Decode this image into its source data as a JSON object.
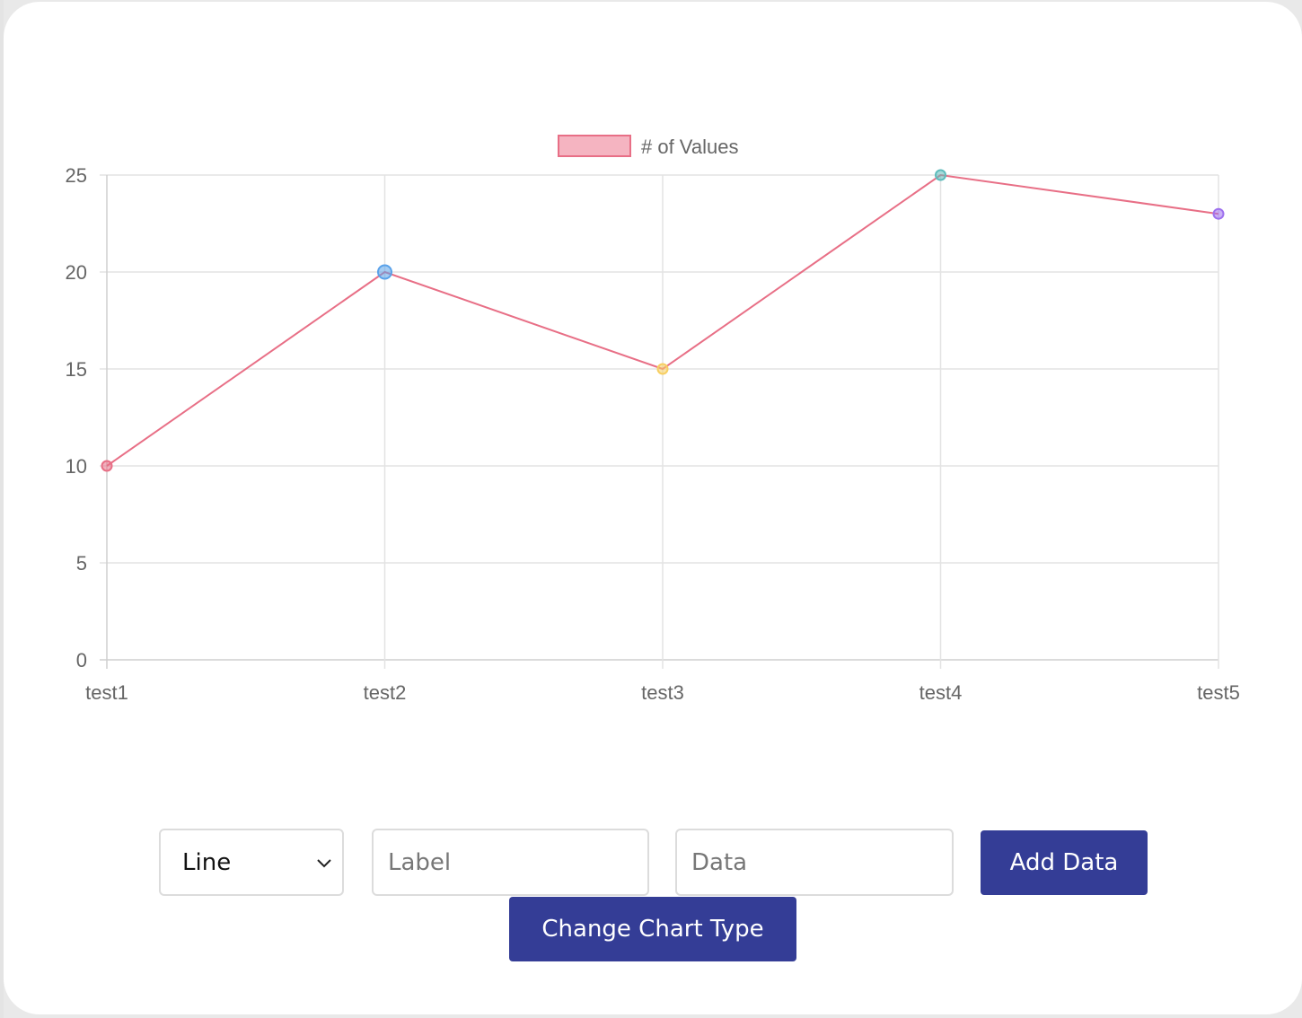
{
  "chart_data": {
    "type": "line",
    "categories": [
      "test1",
      "test2",
      "test3",
      "test4",
      "test5"
    ],
    "series": [
      {
        "name": "# of Values",
        "values": [
          10,
          20,
          15,
          25,
          23
        ],
        "line_color": "#e86f86",
        "legend_fill": "#f5b4c1",
        "point_colors": [
          "#e86f86",
          "#5aa2ea",
          "#f7cf62",
          "#5ebcbc",
          "#9e70ee"
        ]
      }
    ],
    "ylim": [
      0,
      25
    ],
    "yticks": [
      0,
      5,
      10,
      15,
      20,
      25
    ],
    "grid": true,
    "legend_position": "top-center",
    "title": "",
    "xlabel": "",
    "ylabel": ""
  },
  "controls": {
    "chart_type_select": {
      "selected": "Line"
    },
    "label_input": {
      "placeholder": "Label"
    },
    "data_input": {
      "placeholder": "Data"
    },
    "add_button_label": "Add Data",
    "change_button_label": "Change Chart Type"
  },
  "colors": {
    "button_bg": "#343d96",
    "button_text": "#ffffff",
    "grid": "#e3e3e3",
    "axis_text": "#666666"
  }
}
